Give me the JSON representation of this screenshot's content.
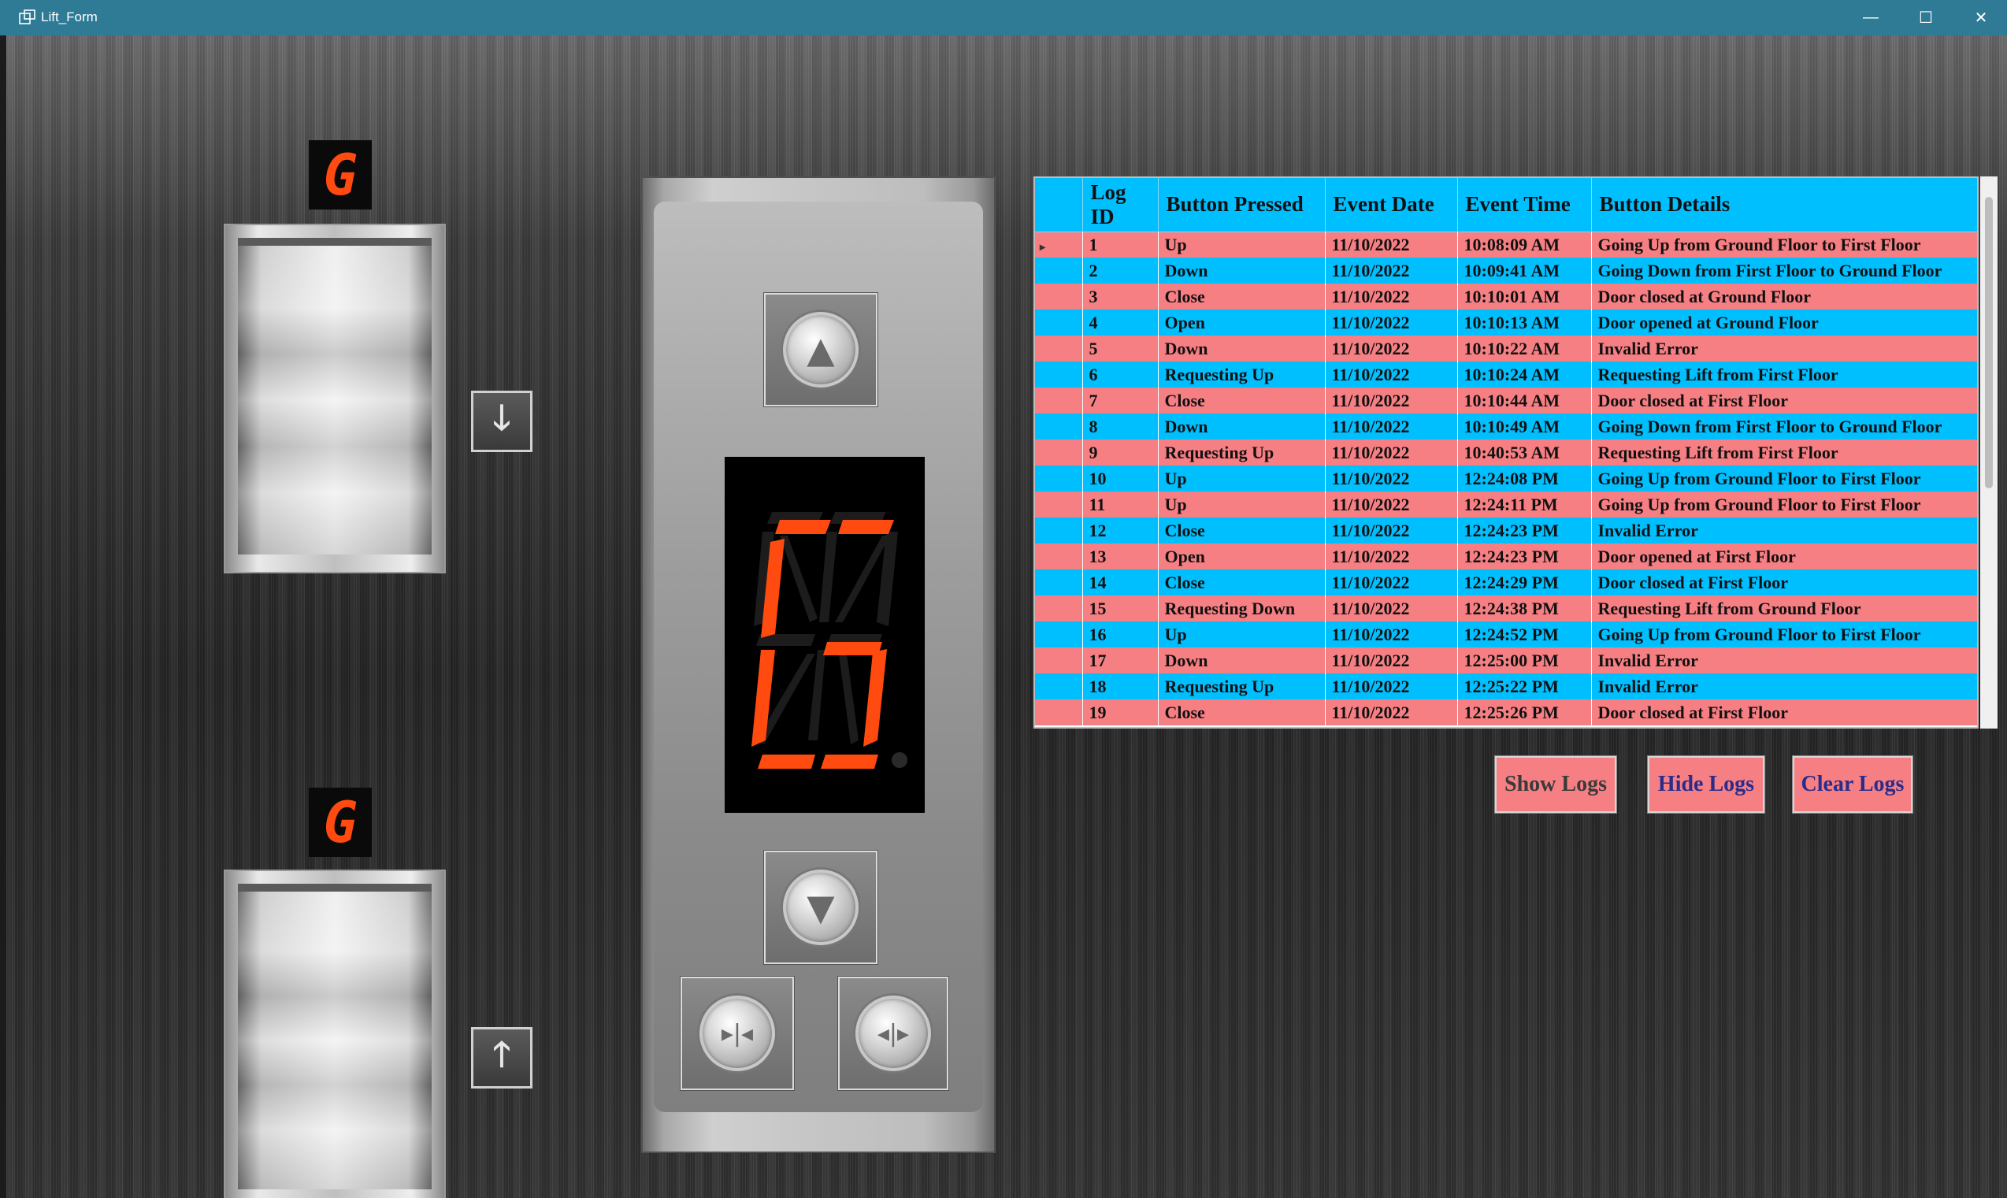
{
  "window": {
    "title": "Lift_Form",
    "controls": {
      "minimize": "—",
      "maximize": "☐",
      "close": "✕"
    }
  },
  "floors": {
    "top_display": "G",
    "bottom_display": "G",
    "top_call_button": "🡓",
    "bottom_call_button": "🡑"
  },
  "panel": {
    "display": "G",
    "up_glyph": "▲",
    "down_glyph": "▼",
    "close_glyph": "▸|◂",
    "open_glyph": "◂|▸"
  },
  "logs": {
    "columns": [
      "Log ID",
      "Button Pressed",
      "Event Date",
      "Event Time",
      "Button Details"
    ],
    "rows": [
      [
        "1",
        "Up",
        "11/10/2022",
        "10:08:09 AM",
        "Going Up from Ground Floor to First Floor"
      ],
      [
        "2",
        "Down",
        "11/10/2022",
        "10:09:41 AM",
        "Going Down from First Floor to Ground Floor"
      ],
      [
        "3",
        "Close",
        "11/10/2022",
        "10:10:01 AM",
        "Door closed at Ground Floor"
      ],
      [
        "4",
        "Open",
        "11/10/2022",
        "10:10:13 AM",
        "Door opened at Ground Floor"
      ],
      [
        "5",
        "Down",
        "11/10/2022",
        "10:10:22 AM",
        "Invalid Error"
      ],
      [
        "6",
        "Requesting Up",
        "11/10/2022",
        "10:10:24 AM",
        "Requesting Lift from First Floor"
      ],
      [
        "7",
        "Close",
        "11/10/2022",
        "10:10:44 AM",
        "Door closed at First Floor"
      ],
      [
        "8",
        "Down",
        "11/10/2022",
        "10:10:49 AM",
        "Going Down from First Floor to Ground Floor"
      ],
      [
        "9",
        "Requesting Up",
        "11/10/2022",
        "10:40:53 AM",
        "Requesting Lift from First Floor"
      ],
      [
        "10",
        "Up",
        "11/10/2022",
        "12:24:08 PM",
        "Going Up from Ground Floor to First Floor"
      ],
      [
        "11",
        "Up",
        "11/10/2022",
        "12:24:11 PM",
        "Going Up from Ground Floor to First Floor"
      ],
      [
        "12",
        "Close",
        "11/10/2022",
        "12:24:23 PM",
        "Invalid Error"
      ],
      [
        "13",
        "Open",
        "11/10/2022",
        "12:24:23 PM",
        "Door opened at First Floor"
      ],
      [
        "14",
        "Close",
        "11/10/2022",
        "12:24:29 PM",
        "Door closed at First Floor"
      ],
      [
        "15",
        "Requesting Down",
        "11/10/2022",
        "12:24:38 PM",
        "Requesting Lift from Ground Floor"
      ],
      [
        "16",
        "Up",
        "11/10/2022",
        "12:24:52 PM",
        "Going Up from Ground Floor to First Floor"
      ],
      [
        "17",
        "Down",
        "11/10/2022",
        "12:25:00 PM",
        "Invalid Error"
      ],
      [
        "18",
        "Requesting Up",
        "11/10/2022",
        "12:25:22 PM",
        "Invalid Error"
      ],
      [
        "19",
        "Close",
        "11/10/2022",
        "12:25:26 PM",
        "Door closed at First Floor"
      ]
    ],
    "selected_marker": "▸"
  },
  "buttons": {
    "show_logs": "Show Logs",
    "hide_logs": "Hide Logs",
    "clear_logs": "Clear Logs"
  },
  "colors": {
    "row_pink": "#f67f83",
    "row_blue": "#00bfff",
    "titlebar": "#2f7b96",
    "display_segment": "#ff4a10"
  }
}
